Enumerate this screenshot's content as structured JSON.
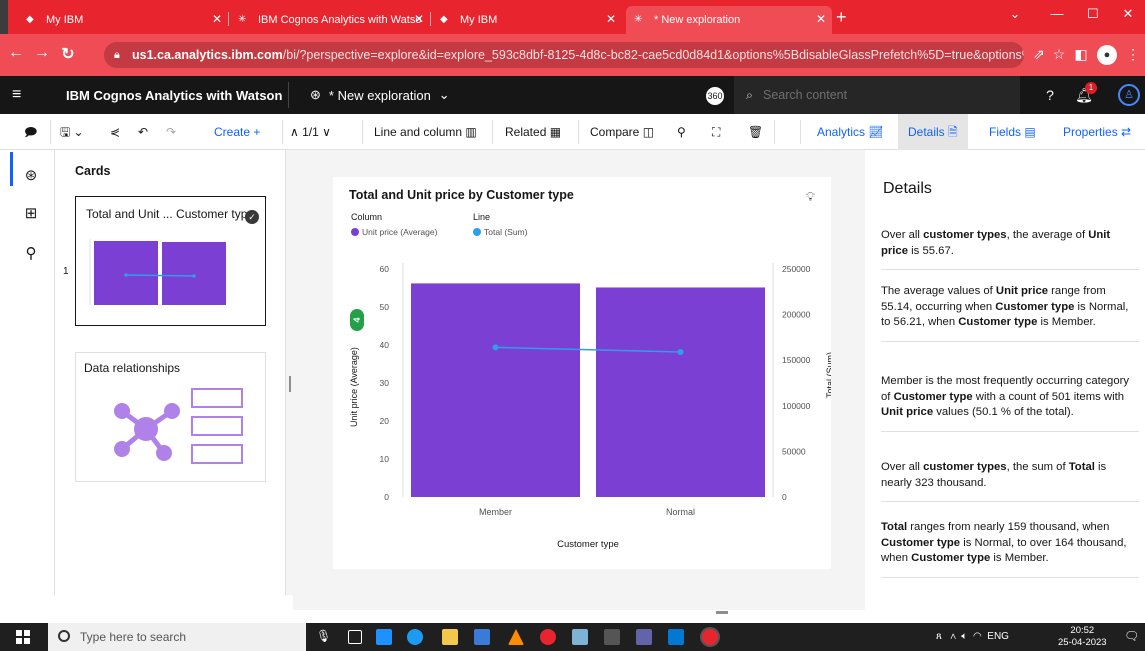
{
  "browser": {
    "tabs": [
      {
        "title": "My IBM"
      },
      {
        "title": "IBM Cognos Analytics with Watso"
      },
      {
        "title": "My IBM"
      },
      {
        "title": "* New exploration"
      }
    ],
    "url_host": "us1.ca.analytics.ibm.com",
    "url_path": "/bi/?perspective=explore&id=explore_593c8dbf-8125-4d8c-bc82-cae5cd0d84d1&options%5BdisableGlassPrefetch%5D=true&options%5Bc..."
  },
  "app": {
    "product_name": "IBM Cognos Analytics with Watson",
    "exploration_title": "* New exploration",
    "badge_360": "360",
    "search_placeholder": "Search content",
    "notification_count": "1"
  },
  "toolbar": {
    "create_label": "Create",
    "page_indicator": "1/1",
    "viz_type_label": "Line and column",
    "related_label": "Related",
    "compare_label": "Compare",
    "analytics_label": "Analytics",
    "details_label": "Details",
    "fields_label": "Fields",
    "properties_label": "Properties"
  },
  "cards_panel": {
    "title": "Cards",
    "card1_title": "Total and Unit ... Customer type",
    "card1_number": "1",
    "card2_title": "Data relationships"
  },
  "viz": {
    "title": "Total and Unit price by Customer type",
    "legend_column_heading": "Column",
    "legend_line_heading": "Line",
    "legend_column_item": "Unit price (Average)",
    "legend_line_item": "Total (Sum)",
    "badge_value": "4",
    "colors": {
      "bar": "#7b3fd3",
      "line": "#2f9ee9",
      "badge": "#24a148"
    }
  },
  "chart_data": {
    "type": "bar",
    "categories": [
      "Member",
      "Normal"
    ],
    "series": [
      {
        "name": "Unit price (Average)",
        "type": "bar",
        "axis": "left",
        "values": [
          56.21,
          55.14
        ]
      },
      {
        "name": "Total (Sum)",
        "type": "line",
        "axis": "right",
        "values": [
          164000,
          159000
        ]
      }
    ],
    "xlabel": "Customer type",
    "ylabel": "Unit price (Average)",
    "y2label": "Total (Sum)",
    "ylim": [
      0,
      60
    ],
    "y2lim": [
      0,
      250000
    ],
    "yticks": [
      "0",
      "10",
      "20",
      "30",
      "40",
      "50",
      "60"
    ],
    "y2ticks": [
      "0",
      "50000",
      "100000",
      "150000",
      "200000",
      "250000"
    ],
    "legend": "top-left",
    "grid": false
  },
  "details": {
    "title": "Details",
    "insights": [
      [
        "Over all ",
        "customer types",
        ", the average of ",
        "Unit price",
        " is 55.67."
      ],
      [
        "The average values of ",
        "Unit price",
        " range from 55.14, occurring when ",
        "Customer type",
        " is Normal, to 56.21, when ",
        "Customer type",
        " is Member."
      ],
      [
        "Member is the most frequently occurring category of ",
        "Customer type",
        " with a count of 501 items with ",
        "Unit price",
        " values (50.1 % of the total)."
      ],
      [
        "Over all ",
        "customer types",
        ", the sum of ",
        "Total",
        " is nearly 323 thousand."
      ],
      [
        "",
        "Total",
        " ranges from nearly 159 thousand, when ",
        "Customer type",
        " is Normal, to over 164 thousand, when ",
        "Customer type",
        " is Member."
      ]
    ]
  },
  "taskbar": {
    "search_placeholder": "Type here to search",
    "language": "ENG",
    "time": "20:52",
    "date": "25-04-2023"
  }
}
